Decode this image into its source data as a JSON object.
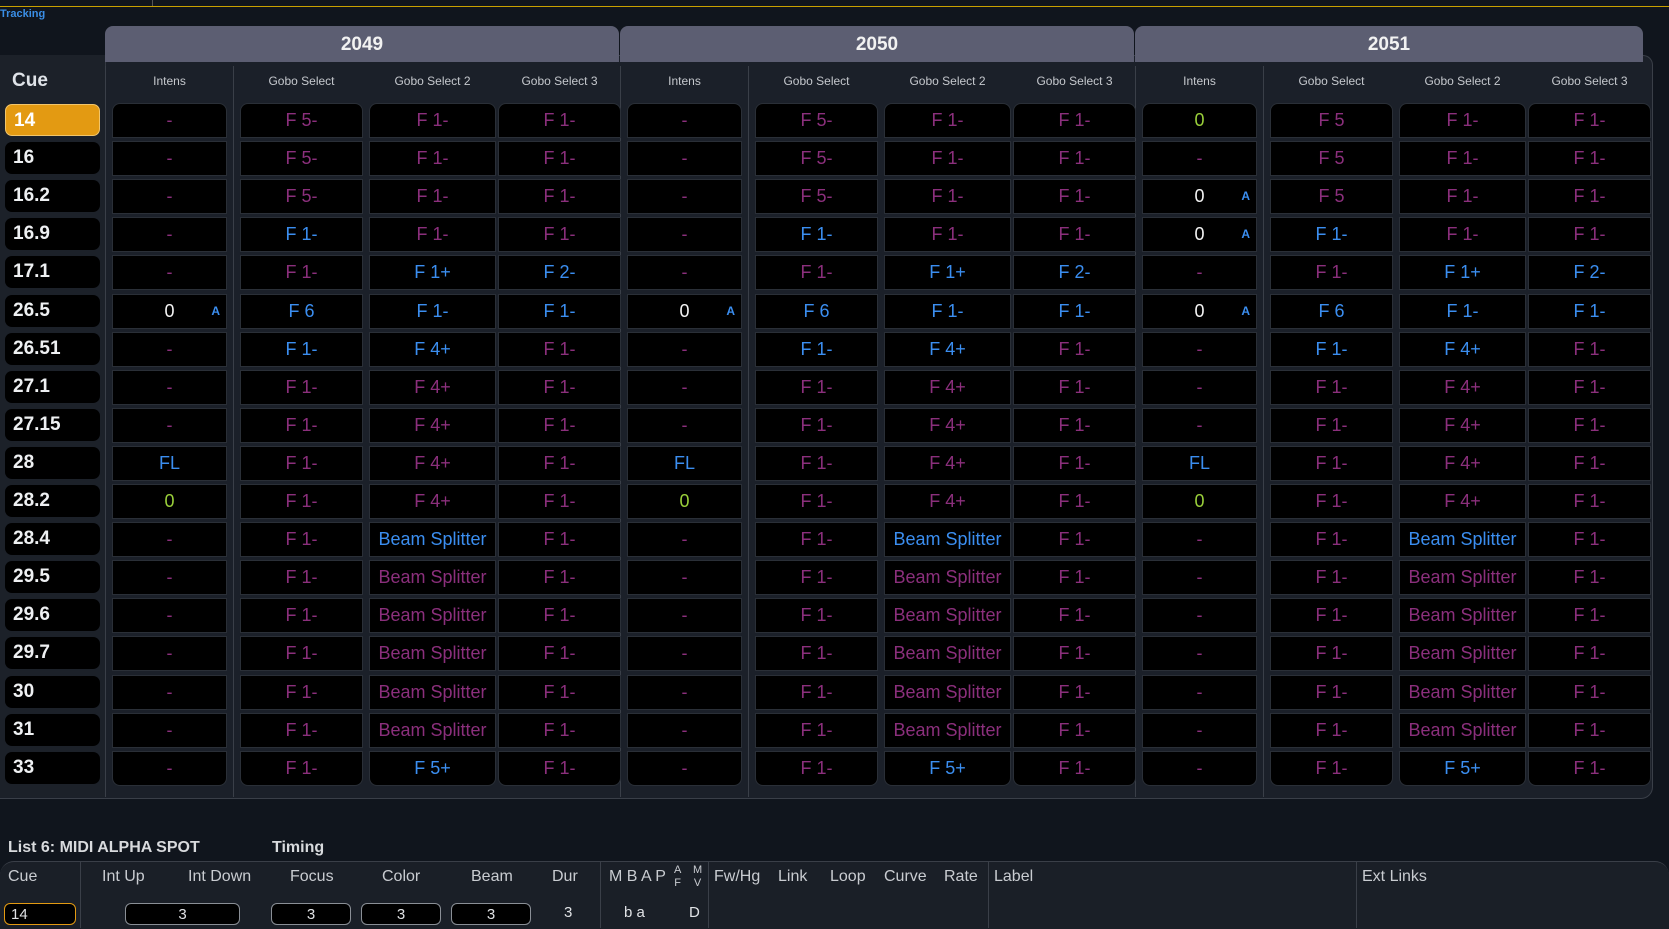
{
  "tracking_label": "Tracking",
  "cue_header": "Cue",
  "groups": [
    {
      "channel": "2049",
      "columns": [
        "Intens",
        "Gobo Select",
        "Gobo Select 2",
        "Gobo Select 3"
      ]
    },
    {
      "channel": "2050",
      "columns": [
        "Intens",
        "Gobo Select",
        "Gobo Select 2",
        "Gobo Select 3"
      ]
    },
    {
      "channel": "2051",
      "columns": [
        "Intens",
        "Gobo Select",
        "Gobo Select 2",
        "Gobo Select 3"
      ]
    }
  ],
  "selected_cue": "14",
  "rows": [
    {
      "cue": "14",
      "cells": [
        [
          {
            "v": "-",
            "s": "dash"
          },
          {
            "v": "F 5-",
            "s": "track"
          },
          {
            "v": "F 1-",
            "s": "track"
          },
          {
            "v": "F 1-",
            "s": "track"
          }
        ],
        [
          {
            "v": "-",
            "s": "dash"
          },
          {
            "v": "F 5-",
            "s": "track"
          },
          {
            "v": "F 1-",
            "s": "track"
          },
          {
            "v": "F 1-",
            "s": "track"
          }
        ],
        [
          {
            "v": "0",
            "s": "green"
          },
          {
            "v": "F 5",
            "s": "track"
          },
          {
            "v": "F 1-",
            "s": "track"
          },
          {
            "v": "F 1-",
            "s": "track"
          }
        ]
      ]
    },
    {
      "cue": "16",
      "cells": [
        [
          {
            "v": "-",
            "s": "dash"
          },
          {
            "v": "F 5-",
            "s": "track"
          },
          {
            "v": "F 1-",
            "s": "track"
          },
          {
            "v": "F 1-",
            "s": "track"
          }
        ],
        [
          {
            "v": "-",
            "s": "dash"
          },
          {
            "v": "F 5-",
            "s": "track"
          },
          {
            "v": "F 1-",
            "s": "track"
          },
          {
            "v": "F 1-",
            "s": "track"
          }
        ],
        [
          {
            "v": "-",
            "s": "dash"
          },
          {
            "v": "F 5",
            "s": "track"
          },
          {
            "v": "F 1-",
            "s": "track"
          },
          {
            "v": "F 1-",
            "s": "track"
          }
        ]
      ]
    },
    {
      "cue": "16.2",
      "cells": [
        [
          {
            "v": "-",
            "s": "dash"
          },
          {
            "v": "F 5-",
            "s": "track"
          },
          {
            "v": "F 1-",
            "s": "track"
          },
          {
            "v": "F 1-",
            "s": "track"
          }
        ],
        [
          {
            "v": "-",
            "s": "dash"
          },
          {
            "v": "F 5-",
            "s": "track"
          },
          {
            "v": "F 1-",
            "s": "track"
          },
          {
            "v": "F 1-",
            "s": "track"
          }
        ],
        [
          {
            "v": "0",
            "s": "white",
            "a": "A"
          },
          {
            "v": "F 5",
            "s": "track"
          },
          {
            "v": "F 1-",
            "s": "track"
          },
          {
            "v": "F 1-",
            "s": "track"
          }
        ]
      ]
    },
    {
      "cue": "16.9",
      "cells": [
        [
          {
            "v": "-",
            "s": "dash"
          },
          {
            "v": "F 1-",
            "s": "blue"
          },
          {
            "v": "F 1-",
            "s": "track"
          },
          {
            "v": "F 1-",
            "s": "track"
          }
        ],
        [
          {
            "v": "-",
            "s": "dash"
          },
          {
            "v": "F 1-",
            "s": "blue"
          },
          {
            "v": "F 1-",
            "s": "track"
          },
          {
            "v": "F 1-",
            "s": "track"
          }
        ],
        [
          {
            "v": "0",
            "s": "white",
            "a": "A"
          },
          {
            "v": "F 1-",
            "s": "blue"
          },
          {
            "v": "F 1-",
            "s": "track"
          },
          {
            "v": "F 1-",
            "s": "track"
          }
        ]
      ]
    },
    {
      "cue": "17.1",
      "cells": [
        [
          {
            "v": "-",
            "s": "dash"
          },
          {
            "v": "F 1-",
            "s": "track"
          },
          {
            "v": "F 1+",
            "s": "blue"
          },
          {
            "v": "F 2-",
            "s": "blue"
          }
        ],
        [
          {
            "v": "-",
            "s": "dash"
          },
          {
            "v": "F 1-",
            "s": "track"
          },
          {
            "v": "F 1+",
            "s": "blue"
          },
          {
            "v": "F 2-",
            "s": "blue"
          }
        ],
        [
          {
            "v": "-",
            "s": "dash"
          },
          {
            "v": "F 1-",
            "s": "track"
          },
          {
            "v": "F 1+",
            "s": "blue"
          },
          {
            "v": "F 2-",
            "s": "blue"
          }
        ]
      ]
    },
    {
      "cue": "26.5",
      "cells": [
        [
          {
            "v": "0",
            "s": "white",
            "a": "A"
          },
          {
            "v": "F 6",
            "s": "blue"
          },
          {
            "v": "F 1-",
            "s": "blue"
          },
          {
            "v": "F 1-",
            "s": "blue"
          }
        ],
        [
          {
            "v": "0",
            "s": "white",
            "a": "A"
          },
          {
            "v": "F 6",
            "s": "blue"
          },
          {
            "v": "F 1-",
            "s": "blue"
          },
          {
            "v": "F 1-",
            "s": "blue"
          }
        ],
        [
          {
            "v": "0",
            "s": "white",
            "a": "A"
          },
          {
            "v": "F 6",
            "s": "blue"
          },
          {
            "v": "F 1-",
            "s": "blue"
          },
          {
            "v": "F 1-",
            "s": "blue"
          }
        ]
      ]
    },
    {
      "cue": "26.51",
      "cells": [
        [
          {
            "v": "-",
            "s": "dash"
          },
          {
            "v": "F 1-",
            "s": "blue"
          },
          {
            "v": "F 4+",
            "s": "blue"
          },
          {
            "v": "F 1-",
            "s": "track"
          }
        ],
        [
          {
            "v": "-",
            "s": "dash"
          },
          {
            "v": "F 1-",
            "s": "blue"
          },
          {
            "v": "F 4+",
            "s": "blue"
          },
          {
            "v": "F 1-",
            "s": "track"
          }
        ],
        [
          {
            "v": "-",
            "s": "dash"
          },
          {
            "v": "F 1-",
            "s": "blue"
          },
          {
            "v": "F 4+",
            "s": "blue"
          },
          {
            "v": "F 1-",
            "s": "track"
          }
        ]
      ]
    },
    {
      "cue": "27.1",
      "cells": [
        [
          {
            "v": "-",
            "s": "dash"
          },
          {
            "v": "F 1-",
            "s": "track"
          },
          {
            "v": "F 4+",
            "s": "track"
          },
          {
            "v": "F 1-",
            "s": "track"
          }
        ],
        [
          {
            "v": "-",
            "s": "dash"
          },
          {
            "v": "F 1-",
            "s": "track"
          },
          {
            "v": "F 4+",
            "s": "track"
          },
          {
            "v": "F 1-",
            "s": "track"
          }
        ],
        [
          {
            "v": "-",
            "s": "dash"
          },
          {
            "v": "F 1-",
            "s": "track"
          },
          {
            "v": "F 4+",
            "s": "track"
          },
          {
            "v": "F 1-",
            "s": "track"
          }
        ]
      ]
    },
    {
      "cue": "27.15",
      "cells": [
        [
          {
            "v": "-",
            "s": "dash"
          },
          {
            "v": "F 1-",
            "s": "track"
          },
          {
            "v": "F 4+",
            "s": "track"
          },
          {
            "v": "F 1-",
            "s": "track"
          }
        ],
        [
          {
            "v": "-",
            "s": "dash"
          },
          {
            "v": "F 1-",
            "s": "track"
          },
          {
            "v": "F 4+",
            "s": "track"
          },
          {
            "v": "F 1-",
            "s": "track"
          }
        ],
        [
          {
            "v": "-",
            "s": "dash"
          },
          {
            "v": "F 1-",
            "s": "track"
          },
          {
            "v": "F 4+",
            "s": "track"
          },
          {
            "v": "F 1-",
            "s": "track"
          }
        ]
      ]
    },
    {
      "cue": "28",
      "cells": [
        [
          {
            "v": "FL",
            "s": "blue"
          },
          {
            "v": "F 1-",
            "s": "track"
          },
          {
            "v": "F 4+",
            "s": "track"
          },
          {
            "v": "F 1-",
            "s": "track"
          }
        ],
        [
          {
            "v": "FL",
            "s": "blue"
          },
          {
            "v": "F 1-",
            "s": "track"
          },
          {
            "v": "F 4+",
            "s": "track"
          },
          {
            "v": "F 1-",
            "s": "track"
          }
        ],
        [
          {
            "v": "FL",
            "s": "blue"
          },
          {
            "v": "F 1-",
            "s": "track"
          },
          {
            "v": "F 4+",
            "s": "track"
          },
          {
            "v": "F 1-",
            "s": "track"
          }
        ]
      ]
    },
    {
      "cue": "28.2",
      "cells": [
        [
          {
            "v": "0",
            "s": "green"
          },
          {
            "v": "F 1-",
            "s": "track"
          },
          {
            "v": "F 4+",
            "s": "track"
          },
          {
            "v": "F 1-",
            "s": "track"
          }
        ],
        [
          {
            "v": "0",
            "s": "green"
          },
          {
            "v": "F 1-",
            "s": "track"
          },
          {
            "v": "F 4+",
            "s": "track"
          },
          {
            "v": "F 1-",
            "s": "track"
          }
        ],
        [
          {
            "v": "0",
            "s": "green"
          },
          {
            "v": "F 1-",
            "s": "track"
          },
          {
            "v": "F 4+",
            "s": "track"
          },
          {
            "v": "F 1-",
            "s": "track"
          }
        ]
      ]
    },
    {
      "cue": "28.4",
      "cells": [
        [
          {
            "v": "-",
            "s": "dash"
          },
          {
            "v": "F 1-",
            "s": "track"
          },
          {
            "v": "Beam Splitter",
            "s": "blue"
          },
          {
            "v": "F 1-",
            "s": "track"
          }
        ],
        [
          {
            "v": "-",
            "s": "dash"
          },
          {
            "v": "F 1-",
            "s": "track"
          },
          {
            "v": "Beam Splitter",
            "s": "blue"
          },
          {
            "v": "F 1-",
            "s": "track"
          }
        ],
        [
          {
            "v": "-",
            "s": "dash"
          },
          {
            "v": "F 1-",
            "s": "track"
          },
          {
            "v": "Beam Splitter",
            "s": "blue"
          },
          {
            "v": "F 1-",
            "s": "track"
          }
        ]
      ]
    },
    {
      "cue": "29.5",
      "cells": [
        [
          {
            "v": "-",
            "s": "dash"
          },
          {
            "v": "F 1-",
            "s": "track"
          },
          {
            "v": "Beam Splitter",
            "s": "track"
          },
          {
            "v": "F 1-",
            "s": "track"
          }
        ],
        [
          {
            "v": "-",
            "s": "dash"
          },
          {
            "v": "F 1-",
            "s": "track"
          },
          {
            "v": "Beam Splitter",
            "s": "track"
          },
          {
            "v": "F 1-",
            "s": "track"
          }
        ],
        [
          {
            "v": "-",
            "s": "dash"
          },
          {
            "v": "F 1-",
            "s": "track"
          },
          {
            "v": "Beam Splitter",
            "s": "track"
          },
          {
            "v": "F 1-",
            "s": "track"
          }
        ]
      ]
    },
    {
      "cue": "29.6",
      "cells": [
        [
          {
            "v": "-",
            "s": "dash"
          },
          {
            "v": "F 1-",
            "s": "track"
          },
          {
            "v": "Beam Splitter",
            "s": "track"
          },
          {
            "v": "F 1-",
            "s": "track"
          }
        ],
        [
          {
            "v": "-",
            "s": "dash"
          },
          {
            "v": "F 1-",
            "s": "track"
          },
          {
            "v": "Beam Splitter",
            "s": "track"
          },
          {
            "v": "F 1-",
            "s": "track"
          }
        ],
        [
          {
            "v": "-",
            "s": "dash"
          },
          {
            "v": "F 1-",
            "s": "track"
          },
          {
            "v": "Beam Splitter",
            "s": "track"
          },
          {
            "v": "F 1-",
            "s": "track"
          }
        ]
      ]
    },
    {
      "cue": "29.7",
      "cells": [
        [
          {
            "v": "-",
            "s": "dash"
          },
          {
            "v": "F 1-",
            "s": "track"
          },
          {
            "v": "Beam Splitter",
            "s": "track"
          },
          {
            "v": "F 1-",
            "s": "track"
          }
        ],
        [
          {
            "v": "-",
            "s": "dash"
          },
          {
            "v": "F 1-",
            "s": "track"
          },
          {
            "v": "Beam Splitter",
            "s": "track"
          },
          {
            "v": "F 1-",
            "s": "track"
          }
        ],
        [
          {
            "v": "-",
            "s": "dash"
          },
          {
            "v": "F 1-",
            "s": "track"
          },
          {
            "v": "Beam Splitter",
            "s": "track"
          },
          {
            "v": "F 1-",
            "s": "track"
          }
        ]
      ]
    },
    {
      "cue": "30",
      "cells": [
        [
          {
            "v": "-",
            "s": "dash"
          },
          {
            "v": "F 1-",
            "s": "track"
          },
          {
            "v": "Beam Splitter",
            "s": "track"
          },
          {
            "v": "F 1-",
            "s": "track"
          }
        ],
        [
          {
            "v": "-",
            "s": "dash"
          },
          {
            "v": "F 1-",
            "s": "track"
          },
          {
            "v": "Beam Splitter",
            "s": "track"
          },
          {
            "v": "F 1-",
            "s": "track"
          }
        ],
        [
          {
            "v": "-",
            "s": "dash"
          },
          {
            "v": "F 1-",
            "s": "track"
          },
          {
            "v": "Beam Splitter",
            "s": "track"
          },
          {
            "v": "F 1-",
            "s": "track"
          }
        ]
      ]
    },
    {
      "cue": "31",
      "cells": [
        [
          {
            "v": "-",
            "s": "dash"
          },
          {
            "v": "F 1-",
            "s": "track"
          },
          {
            "v": "Beam Splitter",
            "s": "track"
          },
          {
            "v": "F 1-",
            "s": "track"
          }
        ],
        [
          {
            "v": "-",
            "s": "dash"
          },
          {
            "v": "F 1-",
            "s": "track"
          },
          {
            "v": "Beam Splitter",
            "s": "track"
          },
          {
            "v": "F 1-",
            "s": "track"
          }
        ],
        [
          {
            "v": "-",
            "s": "dash"
          },
          {
            "v": "F 1-",
            "s": "track"
          },
          {
            "v": "Beam Splitter",
            "s": "track"
          },
          {
            "v": "F 1-",
            "s": "track"
          }
        ]
      ]
    },
    {
      "cue": "33",
      "cells": [
        [
          {
            "v": "-",
            "s": "dash"
          },
          {
            "v": "F 1-",
            "s": "track"
          },
          {
            "v": "F 5+",
            "s": "blue"
          },
          {
            "v": "F 1-",
            "s": "track"
          }
        ],
        [
          {
            "v": "-",
            "s": "dash"
          },
          {
            "v": "F 1-",
            "s": "track"
          },
          {
            "v": "F 5+",
            "s": "blue"
          },
          {
            "v": "F 1-",
            "s": "track"
          }
        ],
        [
          {
            "v": "-",
            "s": "dash"
          },
          {
            "v": "F 1-",
            "s": "track"
          },
          {
            "v": "F 5+",
            "s": "blue"
          },
          {
            "v": "F 1-",
            "s": "track"
          }
        ]
      ]
    }
  ],
  "bottom": {
    "list_title": "List 6: MIDI ALPHA SPOT",
    "timing_title": "Timing",
    "headers": {
      "cue": "Cue",
      "int_up": "Int Up",
      "int_down": "Int Down",
      "focus": "Focus",
      "color": "Color",
      "beam": "Beam",
      "dur": "Dur",
      "mbap": "M B A P",
      "af": "A\nF",
      "mv": "M\nV",
      "fwhg": "Fw/Hg",
      "link": "Link",
      "loop": "Loop",
      "curve": "Curve",
      "rate": "Rate",
      "label": "Label",
      "ext_links": "Ext Links"
    },
    "values": {
      "cue": "14",
      "int_down": "3",
      "focus": "3",
      "color": "3",
      "beam": "3",
      "dur": "3",
      "mbap": "b a",
      "d_flag": "D"
    }
  },
  "colors": {
    "selected_cue": "#e39a12",
    "tracked": "#8b2f7c",
    "changed": "#3b8ef0",
    "intens_zero": "#9ad03a",
    "group_header": "#5c5e72"
  }
}
